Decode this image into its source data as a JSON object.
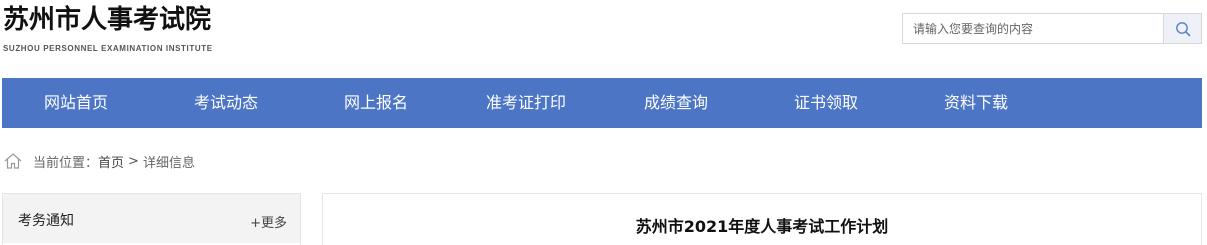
{
  "header": {
    "title": "苏州市人事考试院",
    "subtitle": "SUZHOU PERSONNEL EXAMINATION INSTITUTE"
  },
  "search": {
    "placeholder": "请输入您要查询的内容",
    "button_icon": "search-icon"
  },
  "nav": {
    "items": [
      "网站首页",
      "考试动态",
      "网上报名",
      "准考证打印",
      "成绩查询",
      "证书领取",
      "资料下载"
    ]
  },
  "breadcrumb": {
    "icon": "home-icon",
    "prefix": "当前位置：",
    "home": "首页",
    "separator": ">",
    "current": "详细信息"
  },
  "sidebar": {
    "title": "考务通知",
    "more": "+更多"
  },
  "article": {
    "title": "苏州市2021年度人事考试工作计划"
  },
  "colors": {
    "nav_background": "#4d75c6",
    "nav_text": "#ffffff"
  }
}
